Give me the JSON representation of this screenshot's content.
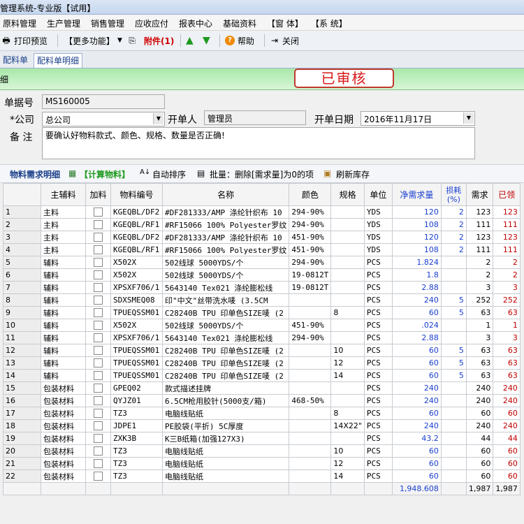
{
  "window": {
    "title": "管理系统-专业版【试用】"
  },
  "menu": [
    "原料管理",
    "生产管理",
    "销售管理",
    "应收应付",
    "报表中心",
    "基础资料",
    "【窗 体】",
    "【系 统】"
  ],
  "toolbar": {
    "print_preview": "打印预览",
    "more": "【更多功能】",
    "attachment": "附件(1)",
    "help": "帮助",
    "close": "关闭"
  },
  "tabs": [
    "配料单",
    "配料单明细"
  ],
  "header": {
    "left_label": "细",
    "status_stamp": "已审核"
  },
  "form": {
    "doc_no_label": "单据号",
    "doc_no": "MS160005",
    "company_label": "*公司",
    "company": "总公司",
    "creator_label": "开单人",
    "creator": "管理员",
    "date_label": "开单日期",
    "date": "2016年11月17日",
    "note_label": "备 注",
    "note": "要确认好物料款式、颜色、规格、数量是否正确!"
  },
  "detail_toolbar": {
    "title": "物料需求明细",
    "calc": "【计算物料】",
    "auto_sort": "自动排序",
    "batch_delete": "批量：删除[需求量]为0的项",
    "refresh_stock": "刷新库存"
  },
  "table": {
    "columns": [
      "主辅料",
      "加料",
      "物料编号",
      "名称",
      "颜色",
      "规格",
      "单位",
      "净需求量",
      "损耗(%)",
      "需求",
      "已领"
    ],
    "rows": [
      [
        "1",
        "主料",
        "KGEQBL/DF2",
        "#DF281333/AMP 涤纶针织布 10",
        "294-90%",
        "",
        "YDS",
        "120",
        "2",
        "123",
        "123"
      ],
      [
        "2",
        "主料",
        "KGEQBL/RF1",
        "#RF15066 100% Polyester罗纹",
        "294-90%",
        "",
        "YDS",
        "108",
        "2",
        "111",
        "111"
      ],
      [
        "3",
        "主料",
        "KGEQBL/DF2",
        "#DF281333/AMP 涤纶针织布 10",
        "451-90%",
        "",
        "YDS",
        "120",
        "2",
        "123",
        "123"
      ],
      [
        "4",
        "主料",
        "KGEQBL/RF1",
        "#RF15066 100% Polyester罗纹",
        "451-90%",
        "",
        "YDS",
        "108",
        "2",
        "111",
        "111"
      ],
      [
        "5",
        "辅料",
        "X502X",
        "502线球 5000YDS/个",
        "294-90%",
        "",
        "PCS",
        "1.824",
        "",
        "2",
        "2"
      ],
      [
        "6",
        "辅料",
        "X502X",
        "502线球 5000YDS/个",
        "19-0812T",
        "",
        "PCS",
        "1.8",
        "",
        "2",
        "2"
      ],
      [
        "7",
        "辅料",
        "XPSXF706/1",
        "5643140 Tex021 涤纶膨松线",
        "19-0812T",
        "",
        "PCS",
        "2.88",
        "",
        "3",
        "3"
      ],
      [
        "8",
        "辅料",
        "SDXSMEQ08",
        "印\"中文\"丝带洗水唛 (3.5CM",
        "",
        "",
        "PCS",
        "240",
        "5",
        "252",
        "252"
      ],
      [
        "9",
        "辅料",
        "TPUEQSSM01",
        "C28240B TPU 印单色SIZE唛 (2",
        "",
        "8",
        "PCS",
        "60",
        "5",
        "63",
        "63"
      ],
      [
        "10",
        "辅料",
        "X502X",
        "502线球 5000YDS/个",
        "451-90%",
        "",
        "PCS",
        ".024",
        "",
        "1",
        "1"
      ],
      [
        "11",
        "辅料",
        "XPSXF706/1",
        "5643140 Tex021 涤纶膨松线",
        "294-90%",
        "",
        "PCS",
        "2.88",
        "",
        "3",
        "3"
      ],
      [
        "12",
        "辅料",
        "TPUEQSSM01",
        "C28240B TPU 印单色SIZE唛 (2",
        "",
        "10",
        "PCS",
        "60",
        "5",
        "63",
        "63"
      ],
      [
        "13",
        "辅料",
        "TPUEQSSM01",
        "C28240B TPU 印单色SIZE唛 (2",
        "",
        "12",
        "PCS",
        "60",
        "5",
        "63",
        "63"
      ],
      [
        "14",
        "辅料",
        "TPUEQSSM01",
        "C28240B TPU 印单色SIZE唛 (2",
        "",
        "14",
        "PCS",
        "60",
        "5",
        "63",
        "63"
      ],
      [
        "15",
        "包装材料",
        "GPEQ02",
        "款式描述挂牌",
        "",
        "",
        "PCS",
        "240",
        "",
        "240",
        "240"
      ],
      [
        "16",
        "包装材料",
        "QYJZ01",
        "6.5CM枪用胶针(5000支/箱)",
        "468-50%",
        "",
        "PCS",
        "240",
        "",
        "240",
        "240"
      ],
      [
        "17",
        "包装材料",
        "TZ3",
        "电脑线贴纸",
        "",
        "8",
        "PCS",
        "60",
        "",
        "60",
        "60"
      ],
      [
        "18",
        "包装材料",
        "JDPE1",
        "PE胶袋(平折) 5C厚度",
        "",
        "14X22\"",
        "PCS",
        "240",
        "",
        "240",
        "240"
      ],
      [
        "19",
        "包装材料",
        "ZXK3B",
        "K三B纸箱(加强127X3)",
        "",
        "",
        "PCS",
        "43.2",
        "",
        "44",
        "44"
      ],
      [
        "20",
        "包装材料",
        "TZ3",
        "电脑线贴纸",
        "",
        "10",
        "PCS",
        "60",
        "",
        "60",
        "60"
      ],
      [
        "21",
        "包装材料",
        "TZ3",
        "电脑线贴纸",
        "",
        "12",
        "PCS",
        "60",
        "",
        "60",
        "60"
      ],
      [
        "22",
        "包装材料",
        "TZ3",
        "电脑线贴纸",
        "",
        "14",
        "PCS",
        "60",
        "",
        "60",
        "60"
      ]
    ],
    "totals": {
      "net": "1,948.608",
      "demand": "1,987",
      "received": "1,987"
    }
  },
  "colors": {
    "accent_blue": "#1a3fd0",
    "accent_red": "#c00000",
    "status_green": "#a8e8a8"
  }
}
